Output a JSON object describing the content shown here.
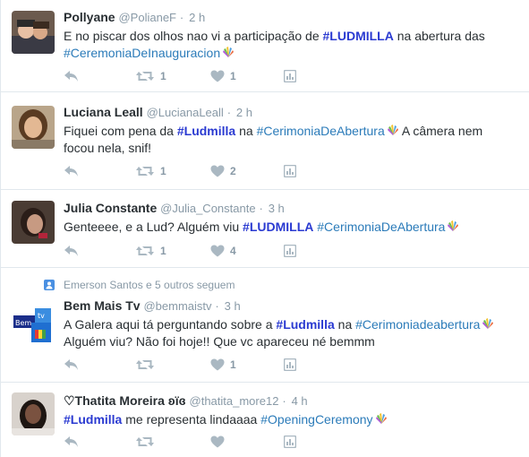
{
  "tweets": [
    {
      "fullname": "Pollyane",
      "username": "@PolianeF",
      "time": "2 h",
      "text_parts": [
        {
          "t": "E no piscar dos olhos nao vi a participação de ",
          "k": "plain"
        },
        {
          "t": "#LUDMILLA",
          "k": "strong"
        },
        {
          "t": "  na abertura das",
          "k": "plain"
        },
        {
          "t": "\n",
          "k": "br"
        },
        {
          "t": "#CeremoniaDeInauguracion",
          "k": "tag"
        }
      ],
      "retweets": "1",
      "likes": "1"
    },
    {
      "fullname": "Luciana Leall",
      "username": "@LucianaLeall",
      "time": "2 h",
      "text_parts": [
        {
          "t": "Fiquei com pena da ",
          "k": "plain"
        },
        {
          "t": "#Ludmilla",
          "k": "strong"
        },
        {
          "t": " na ",
          "k": "plain"
        },
        {
          "t": "#CerimoniaDeAbertura",
          "k": "tag"
        },
        {
          "t": "  A câmera nem",
          "k": "plain"
        },
        {
          "t": "\n",
          "k": "br"
        },
        {
          "t": "focou nela, snif!",
          "k": "plain"
        }
      ],
      "retweets": "1",
      "likes": "2"
    },
    {
      "fullname": "Julia Constante",
      "username": "@Julia_Constante",
      "time": "3 h",
      "text_parts": [
        {
          "t": "Genteeee, e a Lud? Alguém viu ",
          "k": "plain"
        },
        {
          "t": "#LUDMILLA",
          "k": "strong"
        },
        {
          "t": " ",
          "k": "plain"
        },
        {
          "t": "#CerimoniaDeAbertura",
          "k": "tag"
        }
      ],
      "retweets": "1",
      "likes": "4"
    },
    {
      "context": "Emerson Santos e 5 outros seguem",
      "fullname": "Bem Mais Tv",
      "username": "@bemmaistv",
      "time": "3 h",
      "text_parts": [
        {
          "t": "A Galera aqui tá perguntando sobre a ",
          "k": "plain"
        },
        {
          "t": "#Ludmilla",
          "k": "strong"
        },
        {
          "t": " na ",
          "k": "plain"
        },
        {
          "t": "#Cerimoniadeabertura",
          "k": "tag"
        },
        {
          "t": "\n",
          "k": "br"
        },
        {
          "t": "Alguém viu? Não foi hoje!! Que vc apareceu né bemmm",
          "k": "plain"
        }
      ],
      "retweets": "",
      "likes": "1"
    },
    {
      "fullname": "♡Thatita Moreira ʚїɞ",
      "username": "@thatita_more12",
      "time": "4 h",
      "text_parts": [
        {
          "t": "#Ludmilla",
          "k": "strong"
        },
        {
          "t": " me representa lindaaaa ",
          "k": "plain"
        },
        {
          "t": "#OpeningCeremony",
          "k": "tag"
        }
      ],
      "retweets": "",
      "likes": ""
    }
  ],
  "colors": {
    "link": "#2b7bb9",
    "strong_link": "#2a3ad1",
    "muted": "#8899a6",
    "icon": "#aab8c2"
  },
  "icons": {
    "reply": "reply-icon",
    "retweet": "retweet-icon",
    "like": "heart-icon",
    "analytics": "analytics-icon",
    "flame": "olympic-flame-icon"
  }
}
